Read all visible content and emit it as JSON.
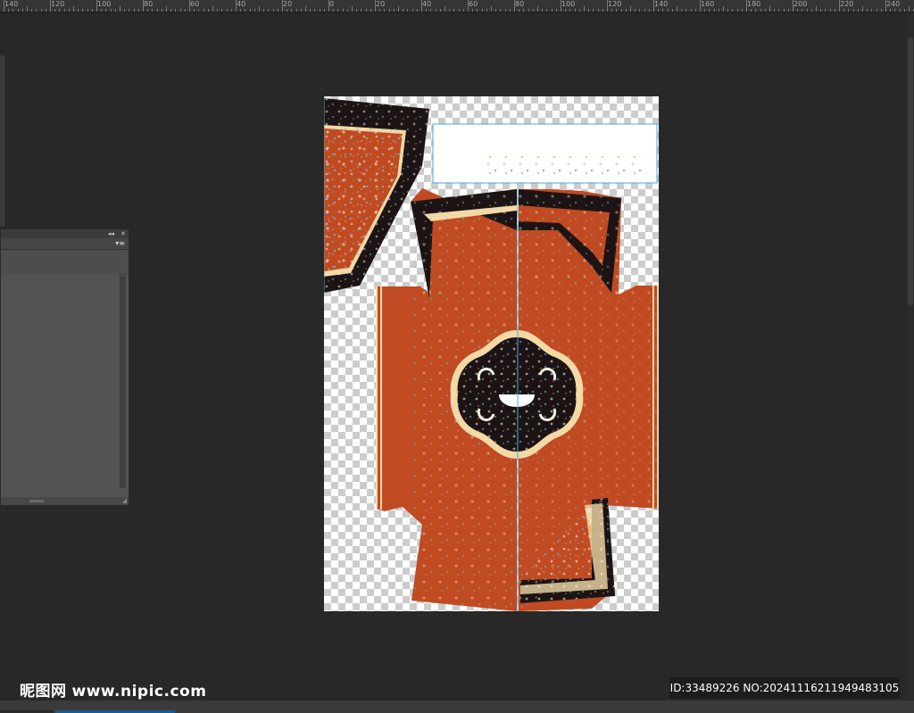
{
  "ruler": {
    "labels": [
      "140",
      "120",
      "100",
      "80",
      "60",
      "40",
      "20",
      "0",
      "20",
      "40",
      "60",
      "80",
      "100",
      "120",
      "140",
      "160",
      "180",
      "200",
      "220",
      "240"
    ]
  },
  "panel": {
    "collapse_icon": "double-chevron-left",
    "close_icon": "close",
    "menu_icon": "panel-menu",
    "collapse_glyph": "◂◂",
    "close_glyph": "✕",
    "menu_glyph": "▾≡"
  },
  "document": {
    "colors": {
      "robe": "#c04a22",
      "border_dark": "#1c1414",
      "trim_light": "#f3d9a6",
      "guide": "#4aa9d6"
    }
  },
  "watermark": {
    "logo_text": "昵图网",
    "site": "www.nipic.com",
    "id_text": "ID:33489226 NO:20241116211949483105"
  }
}
